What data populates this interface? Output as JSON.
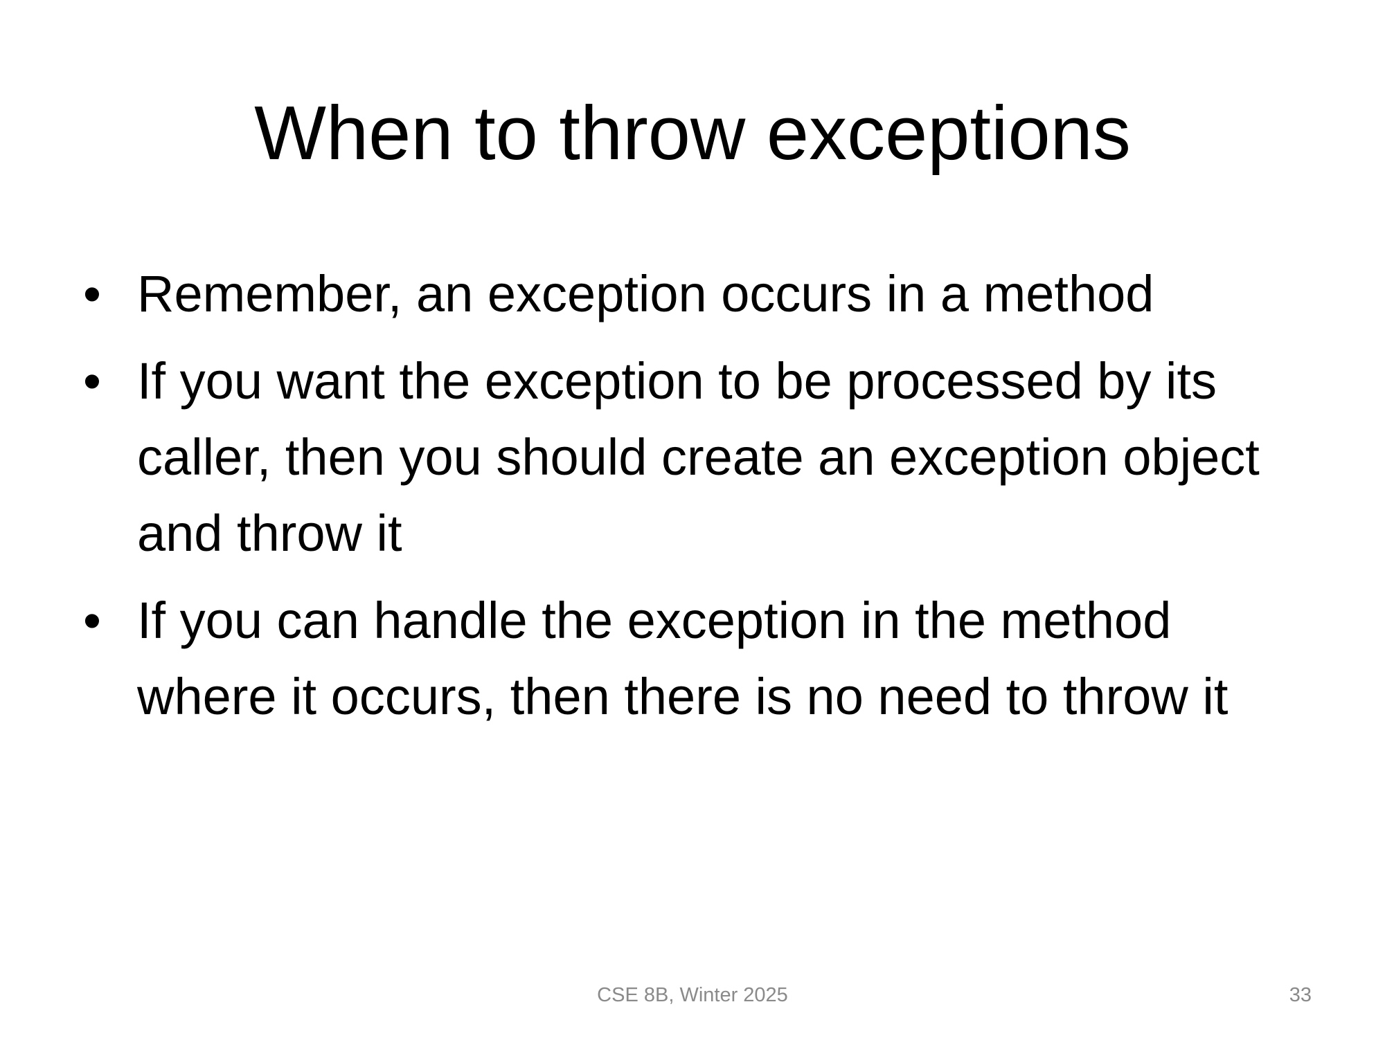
{
  "slide": {
    "title": "When to throw exceptions",
    "bullets": [
      {
        "text": "Remember, an exception occurs in a method"
      },
      {
        "text": "If you want the exception to be processed by its caller, then you should create an exception object and throw it"
      },
      {
        "text": "If you can handle the exception in the method where it occurs, then there is no need to throw it"
      }
    ],
    "bullet_glyph": "•",
    "footer": "CSE 8B, Winter 2025",
    "page_number": "33"
  }
}
